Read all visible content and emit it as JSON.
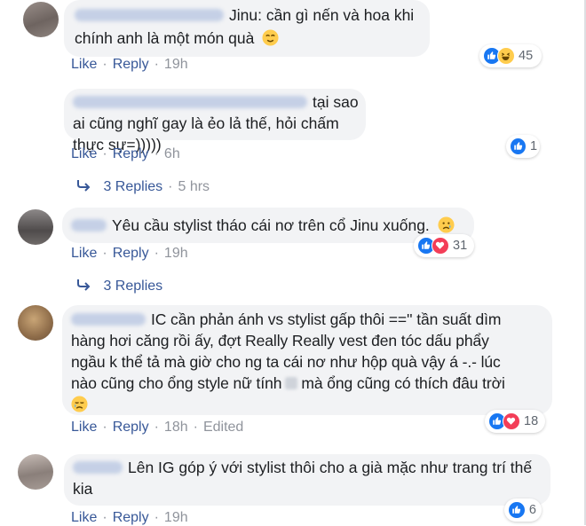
{
  "ui": {
    "like_label": "Like",
    "reply_label": "Reply",
    "edited_label": "Edited",
    "separator": "·"
  },
  "comments": [
    {
      "name_hidden": "Nguyễn Phương Anh",
      "text": "Jinu: cần gì nến và hoa khi chính anh là một món quà",
      "time": "19h",
      "reaction_count": "45"
    },
    {
      "name_hidden": "Anh Sankley Quế Anh Mueon Chan",
      "text": "tại sao ai cũng nghĩ gay là ẻo lả thế, hỏi chấm thực sự=)))))",
      "time": "6h",
      "reaction_count": "1",
      "replies_label": "3 Replies",
      "replies_time": "5 hrs"
    },
    {
      "name_hidden": "Mi Mi",
      "text": "Yêu cầu stylist tháo cái nơ trên cổ Jinu xuống.",
      "time": "19h",
      "reaction_count": "31",
      "replies_label": "3 Replies"
    },
    {
      "name_hidden": "Ngọc Diệu",
      "text_line1": "IC cần phản ánh vs stylist gấp thôi ==''  tần suất dìm",
      "text_line2": "hàng hơi căng rồi ấy, đợt Really Really vest đen tóc dấu phẩy",
      "text_line3": "ngầu k thể tả mà giờ cho ng ta cái nơ như hộp quà vậy á -.- lúc",
      "text_line4a": "nào cũng cho ổng style nữ tính",
      "text_line4b": "mà ổng cũng có thích đâu trời",
      "time": "18h",
      "reaction_count": "18"
    },
    {
      "name_hidden": "Sao Mai",
      "text": "Lên IG góp ý với stylist thôi cho a già mặc như trang trí thế kia",
      "time": "19h",
      "reaction_count": "6"
    }
  ],
  "colors": {
    "like_blue": "#1877f2",
    "love_red": "#f33e58",
    "link": "#385898",
    "bubble": "#f2f3f5",
    "meta": "#90949c"
  }
}
